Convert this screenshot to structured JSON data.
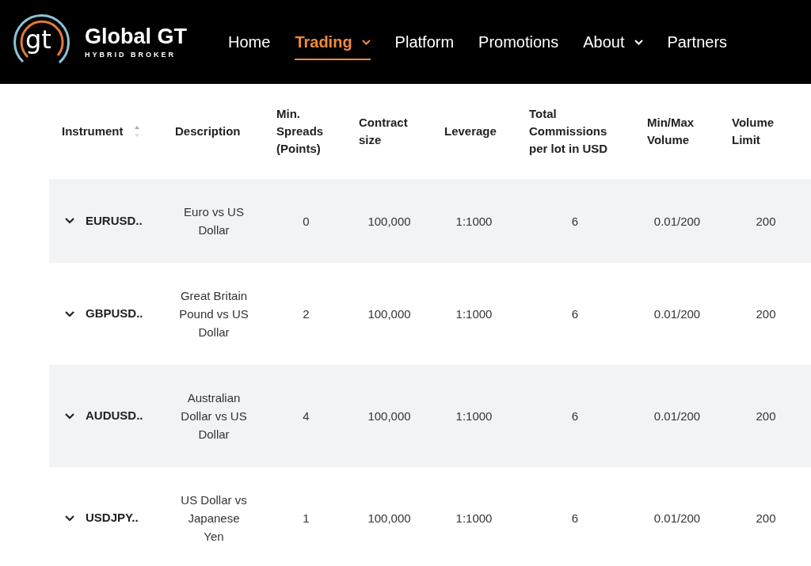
{
  "logo": {
    "mark": "gt",
    "name": "Global GT",
    "tagline": "HYBRID BROKER"
  },
  "nav": [
    {
      "label": "Home",
      "selected": false,
      "dropdown": false
    },
    {
      "label": "Trading",
      "selected": true,
      "dropdown": true
    },
    {
      "label": "Platform",
      "selected": false,
      "dropdown": false
    },
    {
      "label": "Promotions",
      "selected": false,
      "dropdown": false
    },
    {
      "label": "About",
      "selected": false,
      "dropdown": true
    },
    {
      "label": "Partners",
      "selected": false,
      "dropdown": false
    }
  ],
  "table": {
    "columns": [
      {
        "label": "Instrument",
        "sortable": true
      },
      {
        "label": "Description",
        "sortable": false
      },
      {
        "label": "Min. Spreads (Points)",
        "sortable": false
      },
      {
        "label": "Contract size",
        "sortable": false
      },
      {
        "label": "Leverage",
        "sortable": false
      },
      {
        "label": "Total Commissions per lot in USD",
        "sortable": false
      },
      {
        "label": "Min/Max Volume",
        "sortable": false
      },
      {
        "label": "Volume Limit",
        "sortable": false
      }
    ],
    "rows": [
      {
        "instrument": "EURUSD..",
        "description": "Euro vs US Dollar",
        "spreads": "0",
        "contract_size": "100,000",
        "leverage": "1:1000",
        "commissions": "6",
        "min_max_volume": "0.01/200",
        "volume_limit": "200"
      },
      {
        "instrument": "GBPUSD..",
        "description": "Great Britain Pound vs US Dollar",
        "spreads": "2",
        "contract_size": "100,000",
        "leverage": "1:1000",
        "commissions": "6",
        "min_max_volume": "0.01/200",
        "volume_limit": "200"
      },
      {
        "instrument": "AUDUSD..",
        "description": "Australian Dollar vs US Dollar",
        "spreads": "4",
        "contract_size": "100,000",
        "leverage": "1:1000",
        "commissions": "6",
        "min_max_volume": "0.01/200",
        "volume_limit": "200"
      },
      {
        "instrument": "USDJPY..",
        "description": "US Dollar vs Japanese Yen",
        "spreads": "1",
        "contract_size": "100,000",
        "leverage": "1:1000",
        "commissions": "6",
        "min_max_volume": "0.01/200",
        "volume_limit": "200"
      }
    ]
  }
}
